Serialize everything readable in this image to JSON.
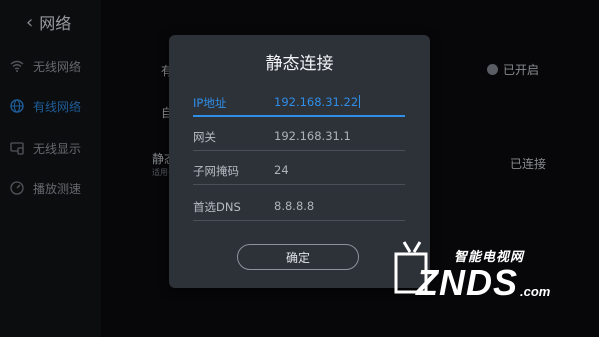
{
  "header": {
    "back_label": "网络"
  },
  "sidebar": {
    "items": [
      {
        "label": "无线网络",
        "icon": "wifi-icon",
        "active": false
      },
      {
        "label": "有线网络",
        "icon": "globe-icon",
        "active": true
      },
      {
        "label": "无线显示",
        "icon": "cast-icon",
        "active": false
      },
      {
        "label": "播放测速",
        "icon": "speedometer-icon",
        "active": false
      }
    ]
  },
  "main": {
    "row1_partial": "有",
    "row1_status": "已开启",
    "row2_partial": "自",
    "row3_partial": "静态",
    "row3_sub_partial": "适用于",
    "row3_status": "已连接"
  },
  "dialog": {
    "title": "静态连接",
    "fields": [
      {
        "label": "IP地址",
        "value": "192.168.31.22",
        "focused": true
      },
      {
        "label": "网关",
        "value": "192.168.31.1",
        "focused": false
      },
      {
        "label": "子网掩码",
        "value": "24",
        "focused": false
      },
      {
        "label": "首选DNS",
        "value": "8.8.8.8",
        "focused": false
      }
    ],
    "ok_label": "确定"
  },
  "watermark": {
    "cn": "智能电视网",
    "main": "ZNDS",
    "suffix": ".com"
  },
  "colors": {
    "accent": "#2f8ee8",
    "dialog_bg": "#2d3138",
    "sidebar_bg": "#121418"
  }
}
